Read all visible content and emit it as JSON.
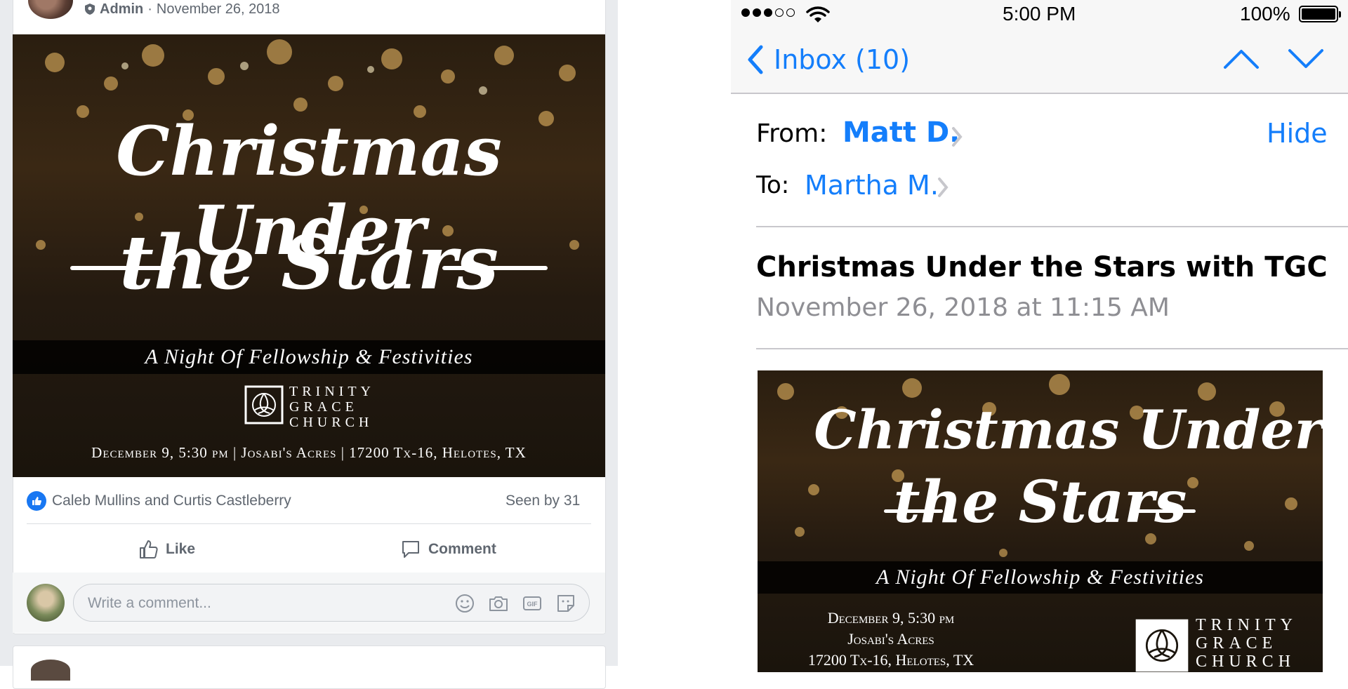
{
  "post": {
    "author_role": "Admin",
    "separator": "·",
    "date": "November 26, 2018",
    "reactions_text": "Caleb Mullins and Curtis Castleberry",
    "seen_by": "Seen by 31",
    "like_label": "Like",
    "comment_label": "Comment",
    "comment_placeholder": "Write a comment..."
  },
  "poster": {
    "title_line1": "Christmas Under",
    "title_line2": "the Stars",
    "tagline": "A Night Of Fellowship & Festivities",
    "church_line1": "TRINITY",
    "church_line2": "GRACE",
    "church_line3": "CHURCH",
    "details": "December 9,  5:30 pm  |  Josabi's Acres  |  17200 Tx-16, Helotes, TX",
    "details_date": "December 9,  5:30 pm",
    "details_venue": "Josabi's Acres",
    "details_address": "17200 Tx-16, Helotes, TX"
  },
  "mail": {
    "status": {
      "time": "5:00 PM",
      "battery": "100%"
    },
    "back_label": "Inbox (10)",
    "from_label": "From:",
    "from_name": "Matt D.",
    "hide_label": "Hide",
    "to_label": "To:",
    "to_name": "Martha M.",
    "subject": "Christmas Under the Stars with TGC",
    "date": "November 26, 2018 at 11:15 AM"
  },
  "colors": {
    "ios_blue": "#147efb",
    "fb_blue": "#1877f2"
  }
}
